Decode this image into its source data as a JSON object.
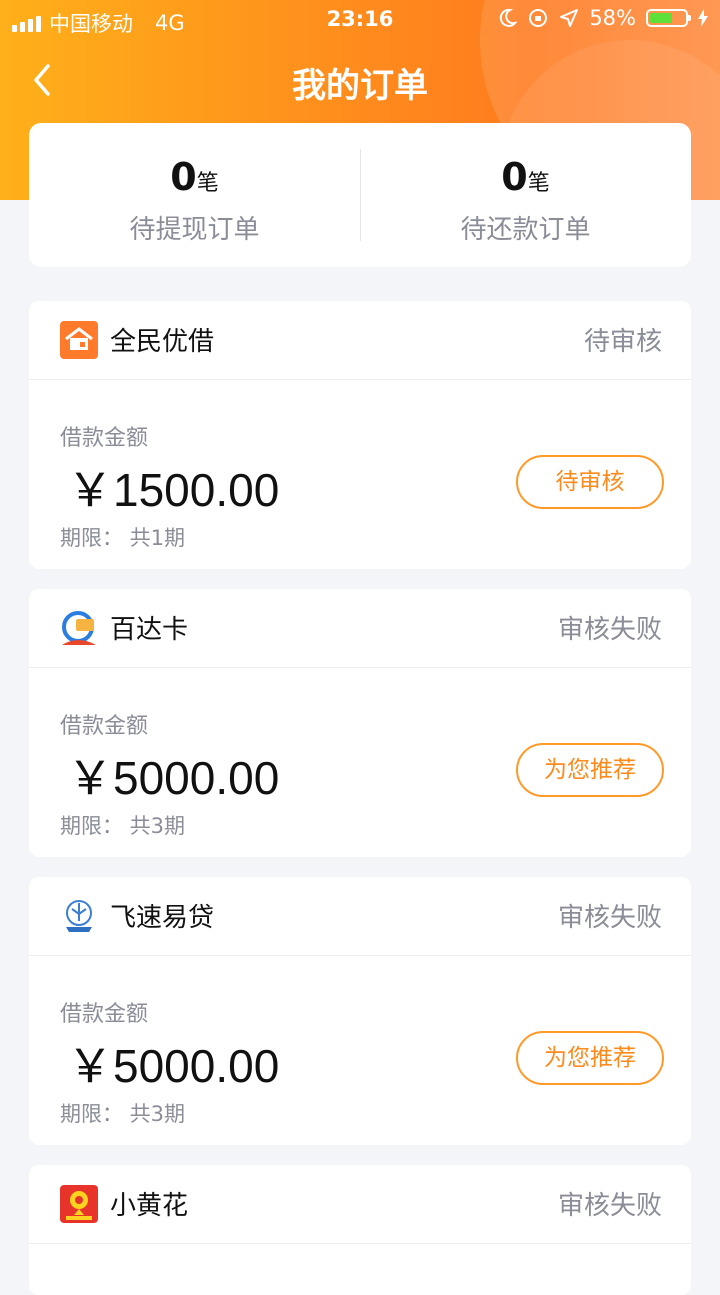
{
  "status_bar": {
    "carrier": "中国移动",
    "network": "4G",
    "time": "23:16",
    "battery": "58%"
  },
  "nav": {
    "title": "我的订单"
  },
  "summary": {
    "withdraw": {
      "count": "0",
      "unit": "笔",
      "label": "待提现订单"
    },
    "repay": {
      "count": "0",
      "unit": "笔",
      "label": "待还款订单"
    }
  },
  "orders": [
    {
      "name": "全民优借",
      "status": "待审核",
      "amount_label": "借款金额",
      "amount": "￥1500.00",
      "term": "期限：  共1期",
      "action": "待审核",
      "logo_icon": "house-icon"
    },
    {
      "name": "百达卡",
      "status": "审核失败",
      "amount_label": "借款金额",
      "amount": "￥5000.00",
      "term": "期限：  共3期",
      "action": "为您推荐",
      "logo_icon": "card-icon"
    },
    {
      "name": "飞速易贷",
      "status": "审核失败",
      "amount_label": "借款金额",
      "amount": "￥5000.00",
      "term": "期限：  共3期",
      "action": "为您推荐",
      "logo_icon": "globe-icon"
    },
    {
      "name": "小黄花",
      "status": "审核失败",
      "logo_icon": "flower-icon"
    }
  ],
  "colors": {
    "accent": "#ff8a1c",
    "header_start": "#ffb01a",
    "header_end": "#ff7a1f",
    "muted_text": "#8a8d98"
  }
}
